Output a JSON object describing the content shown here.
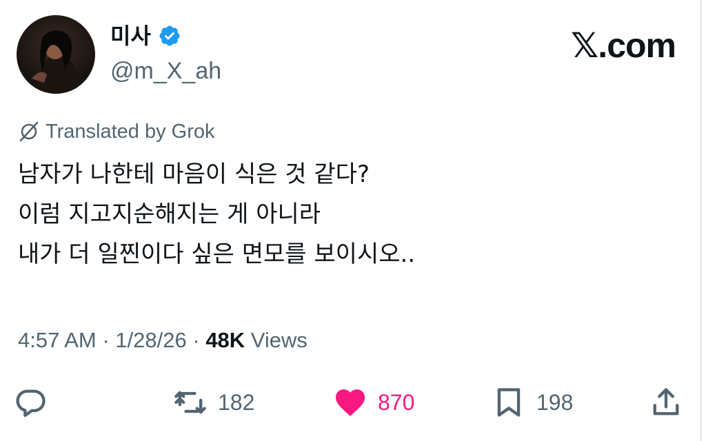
{
  "author": {
    "display_name": "미사",
    "handle": "@m_X_ah",
    "verified": true,
    "avatar_icon": "profile-photo"
  },
  "brand": {
    "text": "𝕏.com"
  },
  "translation": {
    "label": "Translated by Grok",
    "icon": "grok-icon"
  },
  "post": {
    "lines": [
      "남자가 나한테 마음이 식은 것 같다?",
      "이럼 지고지순해지는 게 아니라",
      "내가 더 일찐이다 싶은 면모를 보이시오.."
    ]
  },
  "meta": {
    "time": "4:57 AM",
    "separator1": " · ",
    "date": "1/28/26",
    "separator2": " · ",
    "views_count": "48K",
    "views_label": " Views"
  },
  "actions": {
    "reply": {
      "icon": "reply-icon",
      "count": ""
    },
    "repost": {
      "icon": "repost-icon",
      "count": "182"
    },
    "like": {
      "icon": "heart-icon",
      "count": "870",
      "liked": true
    },
    "bookmark": {
      "icon": "bookmark-icon",
      "count": "198"
    },
    "share": {
      "icon": "share-icon",
      "count": ""
    }
  },
  "colors": {
    "text_primary": "#0f1419",
    "text_secondary": "#536471",
    "verified_blue": "#1d9bf0",
    "like_pink": "#f91880"
  }
}
